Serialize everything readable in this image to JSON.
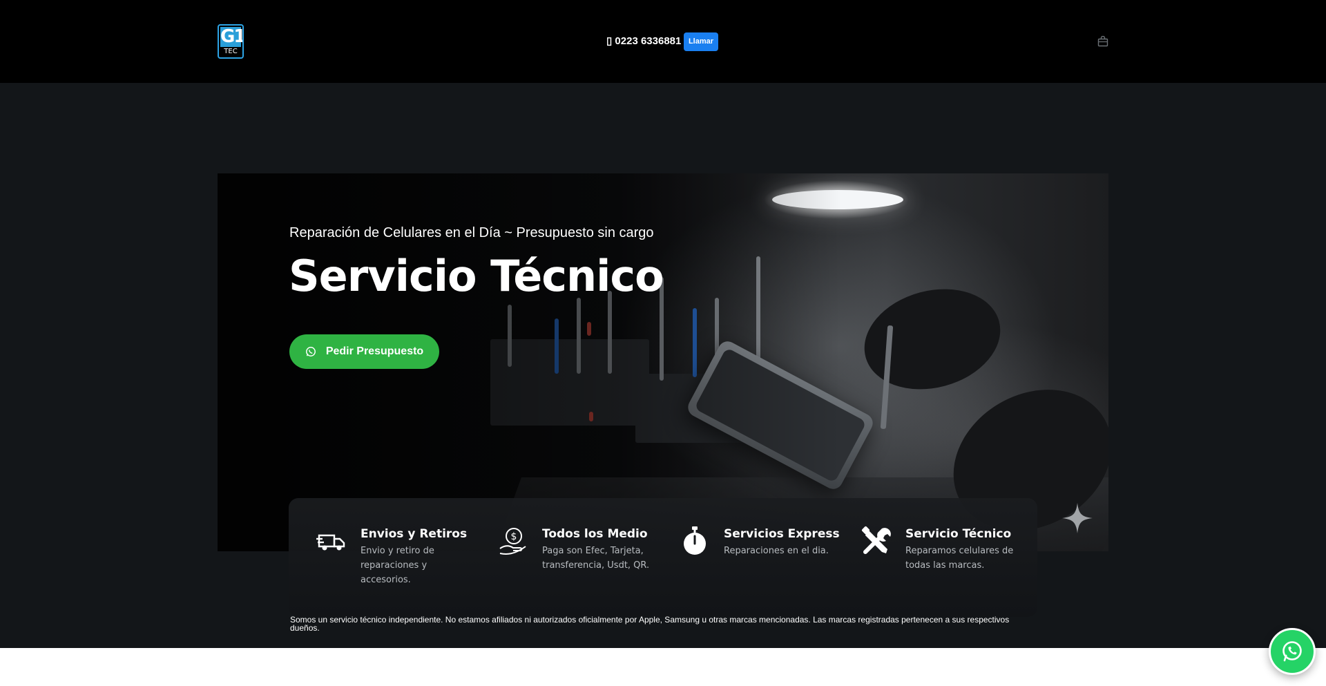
{
  "header": {
    "logo_top": "G1",
    "logo_bottom": "TEC",
    "phone_icon": "phone-icon",
    "phone_number": "0223 6336881",
    "call_label": "Llamar",
    "cart_icon": "shopping-bag-icon"
  },
  "hero": {
    "subtitle": "Reparación de Celulares en el Día ~ Presupuesto sin cargo",
    "title": "Servicio Técnico",
    "cta_label": "Pedir Presupuesto",
    "cta_icon": "whatsapp-icon"
  },
  "features": [
    {
      "icon": "delivery-truck-icon",
      "title": "Envios y Retiros",
      "description": "Envio y retiro de reparaciones y accesorios."
    },
    {
      "icon": "hand-coin-icon",
      "title": "Todos los Medio",
      "description": "Paga son Efec, Tarjeta, transferencia, Usdt, QR."
    },
    {
      "icon": "stopwatch-icon",
      "title": "Servicios Express",
      "description": "Reparaciones en el dia."
    },
    {
      "icon": "tools-icon",
      "title": "Servicio Técnico",
      "description": "Reparamos celulares de todas las marcas."
    }
  ],
  "disclaimer": "Somos un servicio técnico independiente. No estamos afiliados ni autorizados oficialmente por Apple, Samsung u otras marcas mencionadas. Las marcas registradas pertenecen a sus respectivos dueños.",
  "colors": {
    "header_bg": "#000000",
    "section_bg": "#131619",
    "call_button": "#1a7ff0",
    "cta_green": "#2fb343",
    "whatsapp_green": "#25d366"
  }
}
